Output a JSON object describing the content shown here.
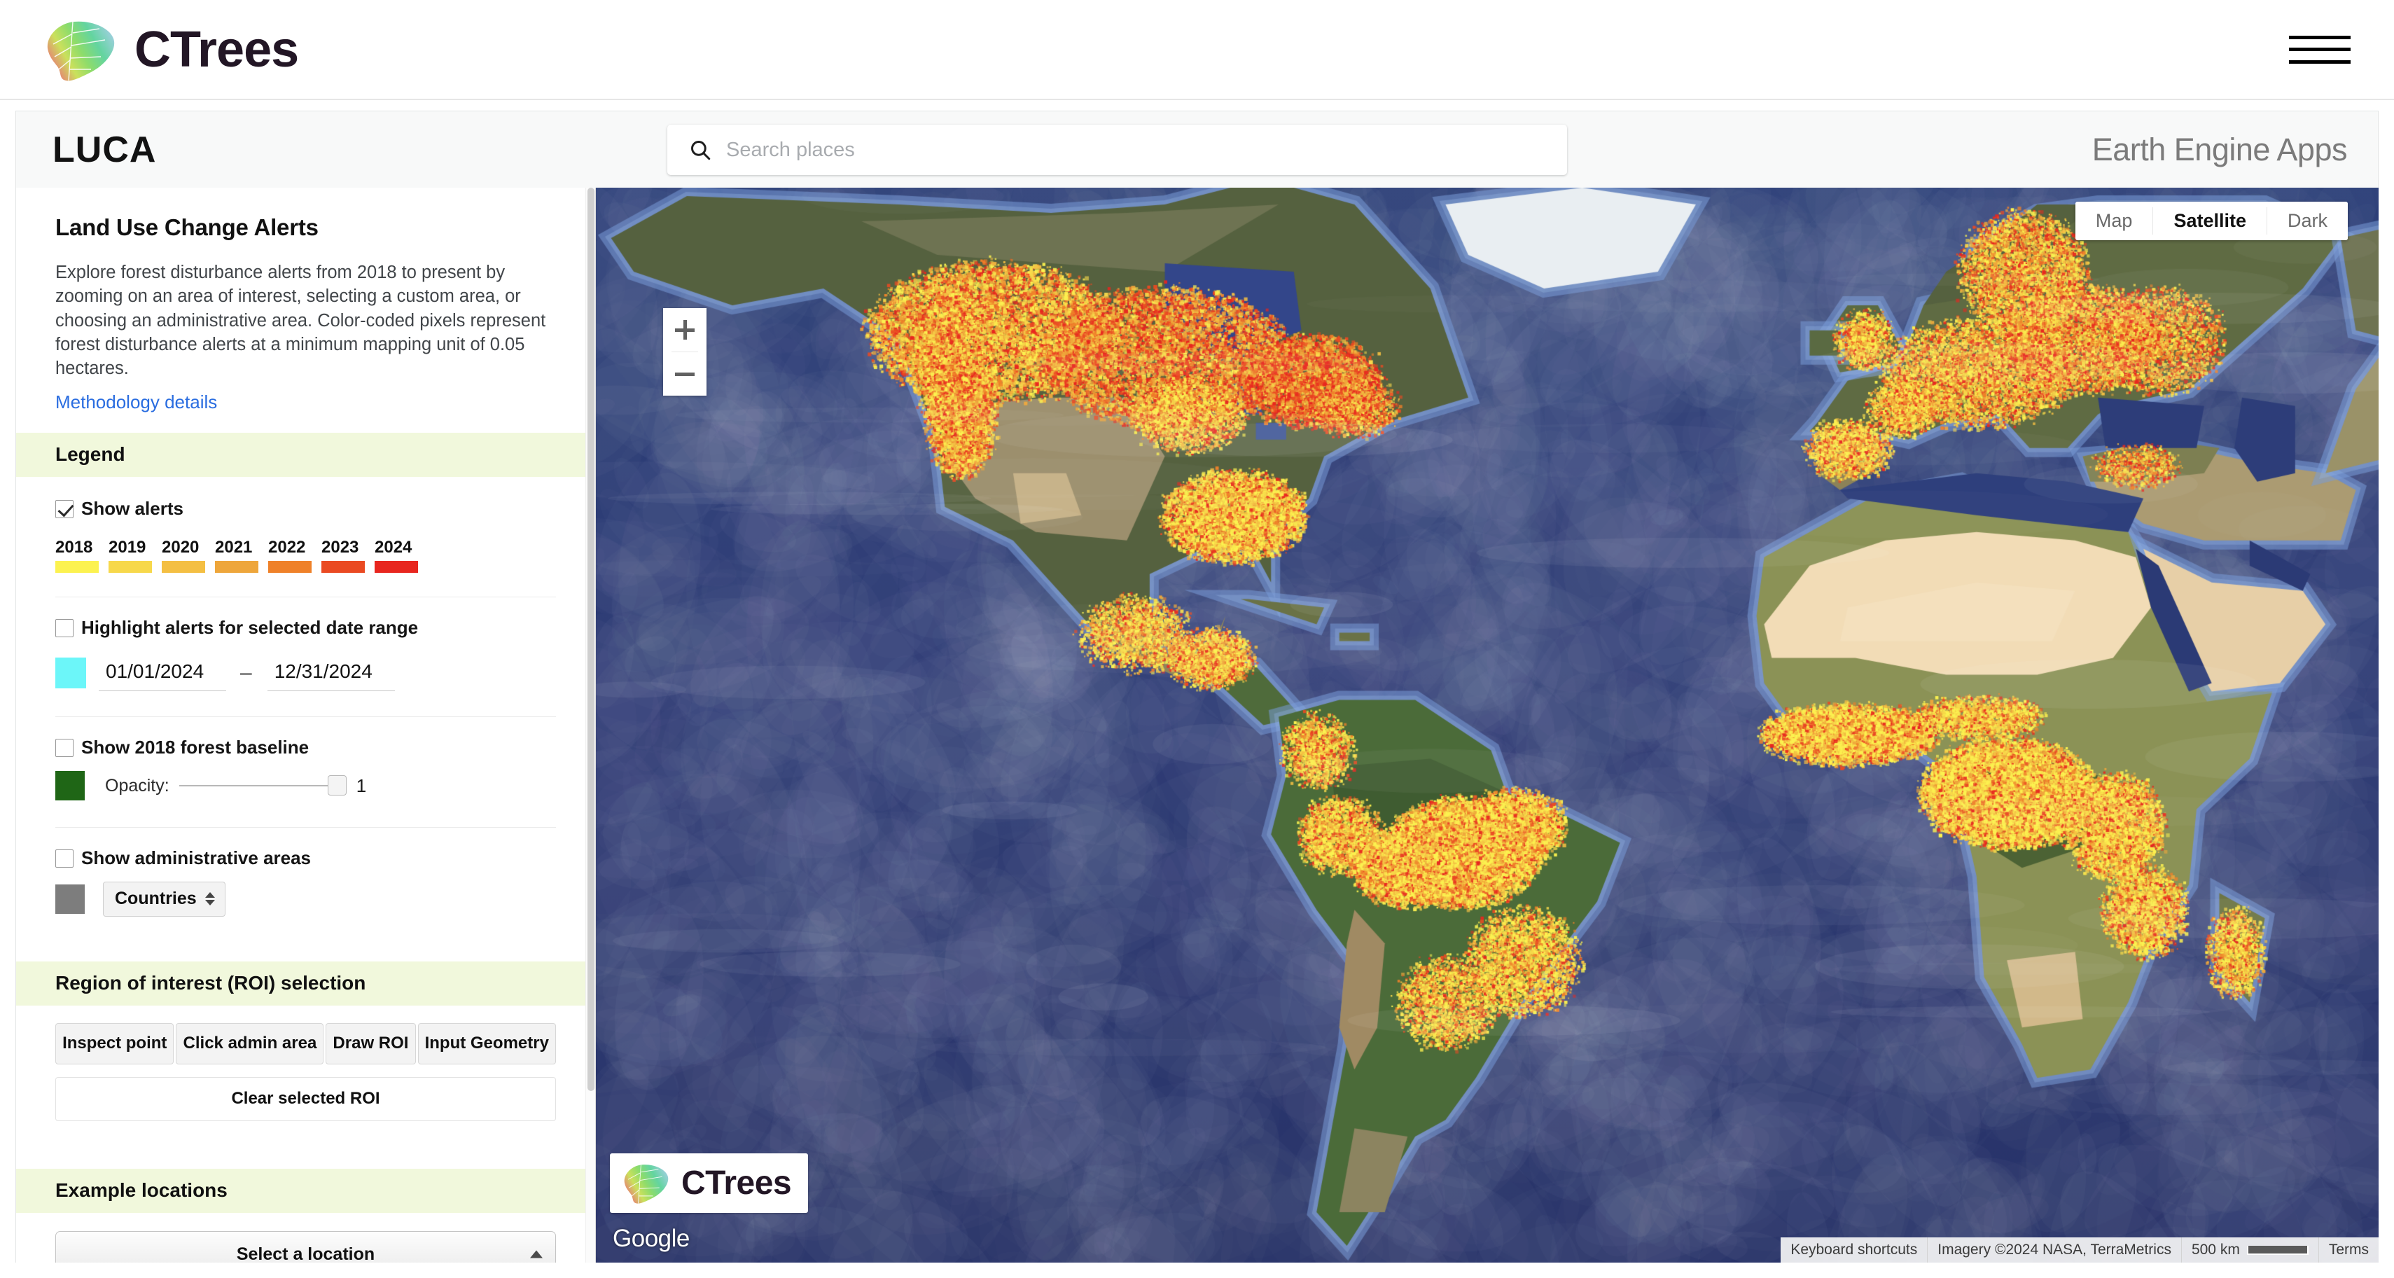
{
  "brand": {
    "name": "CTrees",
    "logo_icon": "ctrees-leaf-logo",
    "menu_icon": "hamburger-menu-icon"
  },
  "appheader": {
    "title": "LUCA",
    "right_label": "Earth Engine Apps",
    "search": {
      "icon": "search-icon",
      "placeholder": "Search places",
      "value": ""
    }
  },
  "sidebar": {
    "panel_title": "Land Use Change Alerts",
    "description": "Explore forest disturbance alerts from 2018 to present by zooming on an area of interest, selecting a custom area, or choosing an administrative area. Color-coded pixels represent forest disturbance alerts at a minimum mapping unit of 0.05 hectares.",
    "methodology_link": "Methodology details",
    "legend": {
      "header": "Legend",
      "show_alerts_label": "Show alerts",
      "show_alerts_checked": true,
      "years": [
        {
          "label": "2018",
          "color": "#fcf250"
        },
        {
          "label": "2019",
          "color": "#f7d84b"
        },
        {
          "label": "2020",
          "color": "#f4bf43"
        },
        {
          "label": "2021",
          "color": "#eea63b"
        },
        {
          "label": "2022",
          "color": "#ef8129"
        },
        {
          "label": "2023",
          "color": "#ea4a22"
        },
        {
          "label": "2024",
          "color": "#e8261f"
        }
      ],
      "highlight": {
        "label": "Highlight alerts for selected date range",
        "checked": false,
        "color": "#6cf6f9",
        "start_date": "01/01/2024",
        "end_date": "12/31/2024",
        "separator": "–"
      },
      "baseline": {
        "label": "Show 2018 forest baseline",
        "checked": false,
        "color": "#1f6616",
        "opacity_label": "Opacity:",
        "opacity_value": "1"
      },
      "admin": {
        "label": "Show administrative areas",
        "checked": false,
        "color": "#7d7d7d",
        "selected_option": "Countries"
      }
    },
    "roi": {
      "header": "Region of interest (ROI) selection",
      "buttons": [
        "Inspect point",
        "Click admin area",
        "Draw ROI",
        "Input Geometry"
      ],
      "clear_label": "Clear selected ROI"
    },
    "examples": {
      "header": "Example locations",
      "select_label": "Select a location"
    }
  },
  "map": {
    "types": [
      {
        "label": "Map",
        "active": false
      },
      {
        "label": "Satellite",
        "active": true
      },
      {
        "label": "Dark",
        "active": false
      }
    ],
    "zoom_in_icon": "plus-icon",
    "zoom_out_icon": "minus-icon",
    "watermark_text": "CTrees",
    "google_logo": "Google",
    "attribution": {
      "keyboard_shortcuts": "Keyboard shortcuts",
      "imagery": "Imagery ©2024 NASA, TerraMetrics",
      "scale": "500 km",
      "terms": "Terms"
    }
  }
}
